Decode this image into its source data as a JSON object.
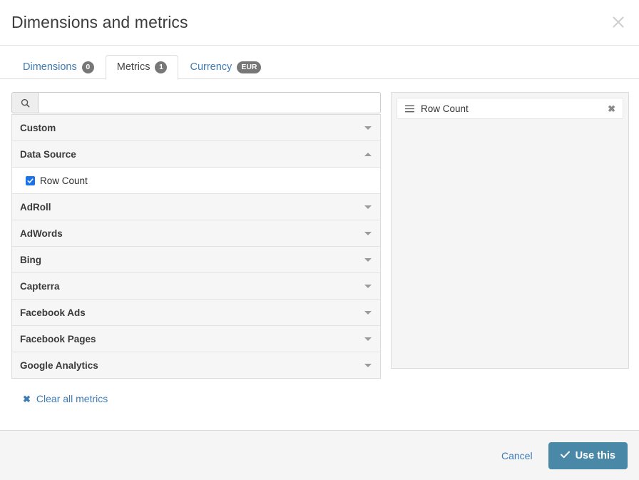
{
  "header": {
    "title": "Dimensions and metrics",
    "close_icon": "close-icon"
  },
  "tabs": [
    {
      "label": "Dimensions",
      "badge": "0",
      "badge_type": "num",
      "active": false
    },
    {
      "label": "Metrics",
      "badge": "1",
      "badge_type": "num",
      "active": true
    },
    {
      "label": "Currency",
      "badge": "EUR",
      "badge_type": "text",
      "active": false
    }
  ],
  "search": {
    "value": "",
    "placeholder": "",
    "icon": "search-icon"
  },
  "groups": [
    {
      "label": "Custom",
      "expanded": false,
      "items": []
    },
    {
      "label": "Data Source",
      "expanded": true,
      "items": [
        {
          "label": "Row Count",
          "checked": true
        }
      ]
    },
    {
      "label": "AdRoll",
      "expanded": false,
      "items": []
    },
    {
      "label": "AdWords",
      "expanded": false,
      "items": []
    },
    {
      "label": "Bing",
      "expanded": false,
      "items": []
    },
    {
      "label": "Capterra",
      "expanded": false,
      "items": []
    },
    {
      "label": "Facebook Ads",
      "expanded": false,
      "items": []
    },
    {
      "label": "Facebook Pages",
      "expanded": false,
      "items": []
    },
    {
      "label": "Google Analytics",
      "expanded": false,
      "items": []
    }
  ],
  "clear_all": {
    "label": "Clear all metrics",
    "icon": "x-icon"
  },
  "selected_panel": {
    "chips": [
      {
        "label": "Row Count",
        "handle_icon": "drag-handle-icon",
        "remove_icon": "remove-icon"
      }
    ]
  },
  "footer": {
    "cancel_label": "Cancel",
    "confirm_label": "Use this",
    "confirm_icon": "check-icon"
  },
  "colors": {
    "link": "#3d7bb5",
    "primary": "#4a88a8",
    "badge": "#777777",
    "checkbox": "#1a73e8"
  }
}
